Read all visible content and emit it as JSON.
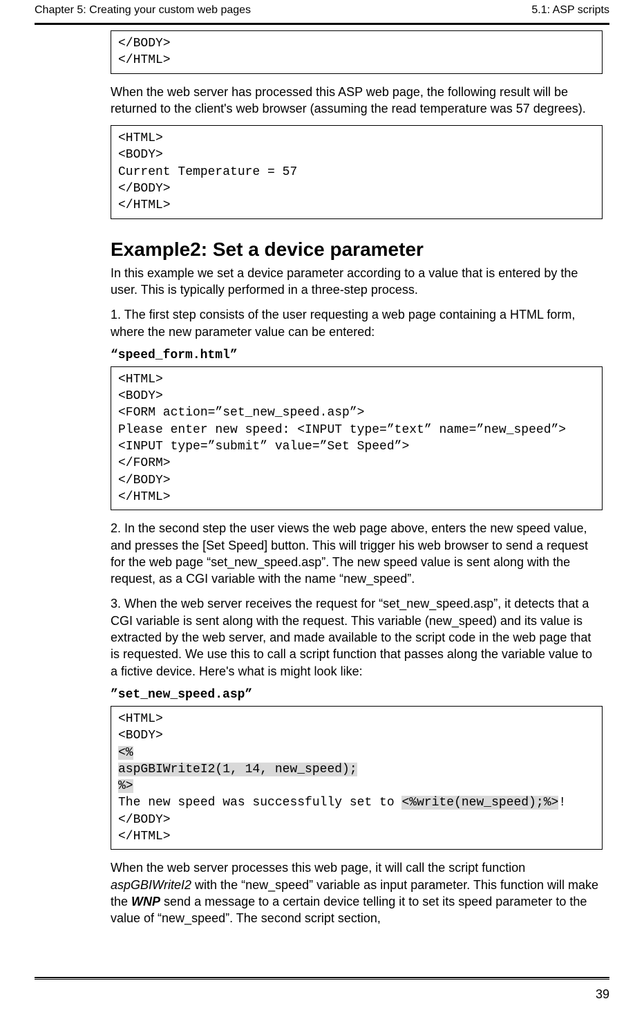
{
  "header": {
    "left": "Chapter 5: Creating your custom web pages",
    "right": "5.1: ASP scripts"
  },
  "code1": "</BODY>\n</HTML>",
  "para1": "When the web server has processed this ASP web page, the following result will be returned to the client's web browser (assuming the read temperature was 57 degrees).",
  "code2": "<HTML>\n<BODY>\nCurrent Temperature = 57\n</BODY>\n</HTML>",
  "heading2": "Example2: Set a device parameter",
  "para2": "In this example we set a device parameter according to a value that is entered by the user. This is typically performed in a three-step process.",
  "para3": "1. The first step consists of the user requesting a web page containing a HTML form, where the new parameter value can be entered:",
  "fname1": "“speed_form.html”",
  "code3": "<HTML>\n<BODY>\n<FORM action=”set_new_speed.asp”>\nPlease enter new speed: <INPUT type=”text” name=”new_speed”>\n<INPUT type=”submit” value=”Set Speed”>\n</FORM>\n</BODY>\n</HTML>",
  "para4": "2. In the second step the user views the web page above, enters the new speed value, and presses the [Set Speed] button. This will trigger his web browser to send a request for the web page “set_new_speed.asp”. The new speed value is sent along with the request, as a CGI variable with the name “new_speed”.",
  "para5": "3. When the web server receives the request for “set_new_speed.asp”, it detects that a CGI variable is sent along with the request. This variable (new_speed) and its value is extracted by the web server, and made available to the script code in the web page that is requested. We use this to call a script function that passes along the variable value to a fictive device. Here's what is might look like:",
  "fname2": "”set_new_speed.asp”",
  "code4_l1": "<HTML>",
  "code4_l2": "<BODY>",
  "code4_l3a": "<%",
  "code4_l3b": "aspGBIWriteI2(1, 14, new_speed);",
  "code4_l3c": "%>",
  "code4_l4a": "The new speed was successfully set to ",
  "code4_l4b": "<%write(new_speed);%>",
  "code4_l4c": "!",
  "code4_l5": "</BODY>",
  "code4_l6": "</HTML>",
  "para6a": "When the web server processes this web page, it will call the script function ",
  "para6b": "aspGBIWriteI2",
  "para6c": " with the “new_speed” variable as input parameter. This function will make the ",
  "para6d": "WNP",
  "para6e": " send a message to a certain device telling it to set its speed parameter to the value of “new_speed”. The second script section,",
  "pagenum": "39"
}
